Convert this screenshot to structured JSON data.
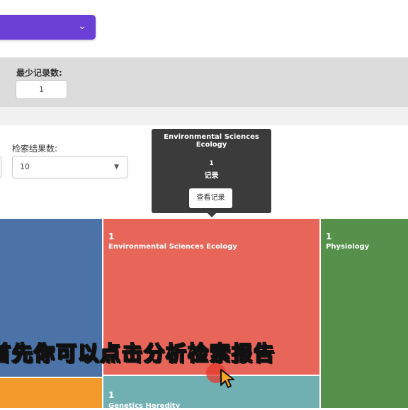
{
  "filters": {
    "min_records_label": "最少记录数:",
    "min_records_value": "1",
    "result_count_label": "检索结果数:",
    "result_count_value": "10"
  },
  "tooltip": {
    "title": "Environmental Sciences Ecology",
    "count": "1",
    "unit": "记录",
    "button_label": "查看记录"
  },
  "treemap": {
    "tiles": [
      {
        "count": "1",
        "name": "Environmental Sciences Ecology",
        "color": "#e8655a"
      },
      {
        "count": "1",
        "name": "Physiology",
        "color": "#55914a"
      },
      {
        "count": "1",
        "name": "Genetics Heredity",
        "color": "#70b0b2"
      },
      {
        "count": "",
        "name": "",
        "color": "#4b73a7"
      },
      {
        "count": "",
        "name": "",
        "color": "#f39a2c"
      }
    ]
  },
  "subtitle": "首先你可以点击分析检索报告",
  "colors": {
    "accent": "#6a3fd6",
    "tooltip_bg": "#3b3b3b",
    "subtitle": "#ffe600"
  },
  "icons": {
    "dropdown": "chevron-down-icon",
    "select_caret": "caret-down-icon",
    "pointer": "cursor-arrow-icon"
  }
}
